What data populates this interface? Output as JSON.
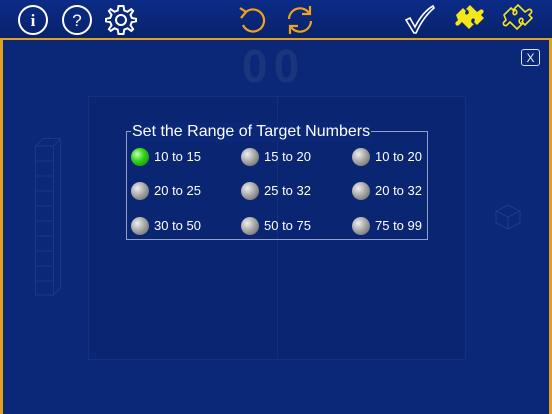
{
  "toolbar": {
    "buttons": [
      {
        "icon": "info-icon"
      },
      {
        "icon": "help-icon"
      },
      {
        "icon": "gear-icon"
      },
      {
        "icon": "undo-icon"
      },
      {
        "icon": "refresh-icon"
      },
      {
        "icon": "check-icon"
      },
      {
        "icon": "puzzle-filled-icon"
      },
      {
        "icon": "puzzle-outline-icon"
      }
    ],
    "colors": {
      "icon": "#ffffff",
      "undo": "#f0a21c",
      "refresh": "#f0a21c",
      "puzzle": "#f5e61a",
      "frame": "#e0a11e"
    },
    "info_glyph": "i",
    "help_glyph": "?"
  },
  "board": {
    "digits": "00",
    "close_label": "X"
  },
  "range_panel": {
    "title": "Set the Range of Target Numbers",
    "options": [
      {
        "label": "10 to 15",
        "selected": true
      },
      {
        "label": "15 to 20",
        "selected": false
      },
      {
        "label": "10 to 20",
        "selected": false
      },
      {
        "label": "20 to 25",
        "selected": false
      },
      {
        "label": "25 to 32",
        "selected": false
      },
      {
        "label": "20 to 32",
        "selected": false
      },
      {
        "label": "30 to 50",
        "selected": false
      },
      {
        "label": "50 to 75",
        "selected": false
      },
      {
        "label": "75 to 99",
        "selected": false
      }
    ],
    "colors": {
      "selected": "#34d61a",
      "unselected": "#a8a8a8"
    }
  }
}
